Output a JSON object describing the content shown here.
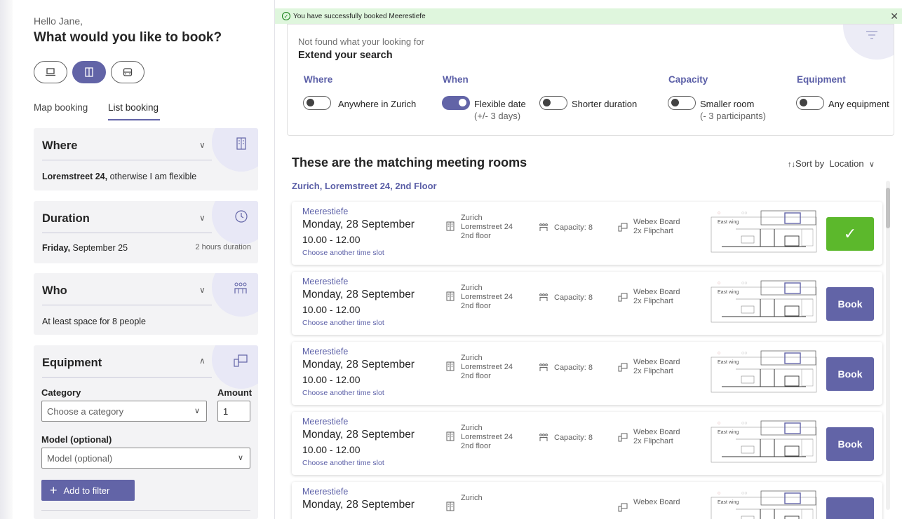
{
  "sidebar": {
    "greeting": "Hello Jane,",
    "question": "What would you like to book?",
    "resource_types": [
      {
        "icon": "laptop-icon",
        "selected": false
      },
      {
        "icon": "room-door-icon",
        "selected": true
      },
      {
        "icon": "car-icon",
        "selected": false
      }
    ],
    "tabs": [
      "Map booking",
      "List booking"
    ],
    "active_tab": "List booking",
    "where": {
      "title": "Where",
      "value_bold": "Loremstreet 24,",
      "value_rest": " otherwise I am flexible",
      "icon": "building-icon"
    },
    "duration": {
      "title": "Duration",
      "date_bold": "Friday,",
      "date_rest": " September 25",
      "length": "2 hours duration",
      "icon": "clock-icon"
    },
    "who": {
      "title": "Who",
      "value": "At least space for 8 people",
      "icon": "people-icon"
    },
    "equipment": {
      "title": "Equipment",
      "icon": "board-icon",
      "category_label": "Category",
      "amount_label": "Amount",
      "category_placeholder": "Choose a category",
      "amount_value": "1",
      "model_label": "Model (optional)",
      "model_placeholder": "Model (optional)",
      "add_button": "Add to filter"
    }
  },
  "banner": {
    "message": "You have successfully booked Meerestiefe",
    "color": "#dff6dd"
  },
  "extend": {
    "subtitle": "Not found what your looking for",
    "title": "Extend your search",
    "filters": [
      {
        "heading": "Where",
        "label": "Anywhere in Zurich",
        "sub": "",
        "on": false
      },
      {
        "heading": "When",
        "label": "Flexible date",
        "sub": "(+/- 3 days)",
        "on": true
      },
      {
        "heading": "",
        "label": "Shorter duration",
        "sub": "",
        "on": false
      },
      {
        "heading": "Capacity",
        "label": "Smaller room",
        "sub": "(- 3 participants)",
        "on": false
      },
      {
        "heading": "Equipment",
        "label": "Any equipment",
        "sub": "",
        "on": false
      }
    ]
  },
  "results": {
    "heading": "These are the matching meeting rooms",
    "sort_label": "Sort by",
    "sort_value": "Location",
    "location_group": "Zurich, Loremstreet 24, 2nd Floor",
    "rooms": [
      {
        "name": "Meerestiefe",
        "date": "Monday, 28 September",
        "time": "10.00 - 12.00",
        "choose": "Choose another time slot",
        "city": "Zurich",
        "street": "Loremstreet 24",
        "floor": "2nd floor",
        "capacity": "Capacity: 8",
        "equip1": "Webex Board",
        "equip2": "2x Flipchart",
        "map_label": "East wing",
        "action": "",
        "booked": true
      },
      {
        "name": "Meerestiefe",
        "date": "Monday, 28 September",
        "time": "10.00 - 12.00",
        "choose": "Choose another time slot",
        "city": "Zurich",
        "street": "Loremstreet 24",
        "floor": "2nd floor",
        "capacity": "Capacity: 8",
        "equip1": "Webex Board",
        "equip2": "2x Flipchart",
        "map_label": "East wing",
        "action": "Book",
        "booked": false
      },
      {
        "name": "Meerestiefe",
        "date": "Monday, 28 September",
        "time": "10.00 - 12.00",
        "choose": "Choose another time slot",
        "city": "Zurich",
        "street": "Loremstreet 24",
        "floor": "2nd floor",
        "capacity": "Capacity: 8",
        "equip1": "Webex Board",
        "equip2": "2x Flipchart",
        "map_label": "East wing",
        "action": "Book",
        "booked": false
      },
      {
        "name": "Meerestiefe",
        "date": "Monday, 28 September",
        "time": "10.00 - 12.00",
        "choose": "Choose another time slot",
        "city": "Zurich",
        "street": "Loremstreet 24",
        "floor": "2nd floor",
        "capacity": "Capacity: 8",
        "equip1": "Webex Board",
        "equip2": "2x Flipchart",
        "map_label": "East wing",
        "action": "Book",
        "booked": false
      },
      {
        "name": "Meerestiefe",
        "date": "Monday, 28 September",
        "time": "",
        "choose": "",
        "city": "Zurich",
        "street": "",
        "floor": "",
        "capacity": "",
        "equip1": "Webex Board",
        "equip2": "",
        "map_label": "East wing",
        "action": "",
        "booked": false
      }
    ]
  },
  "colors": {
    "accent": "#6264a7",
    "success": "#5cb82c",
    "card_bg": "#f3f3f5"
  }
}
